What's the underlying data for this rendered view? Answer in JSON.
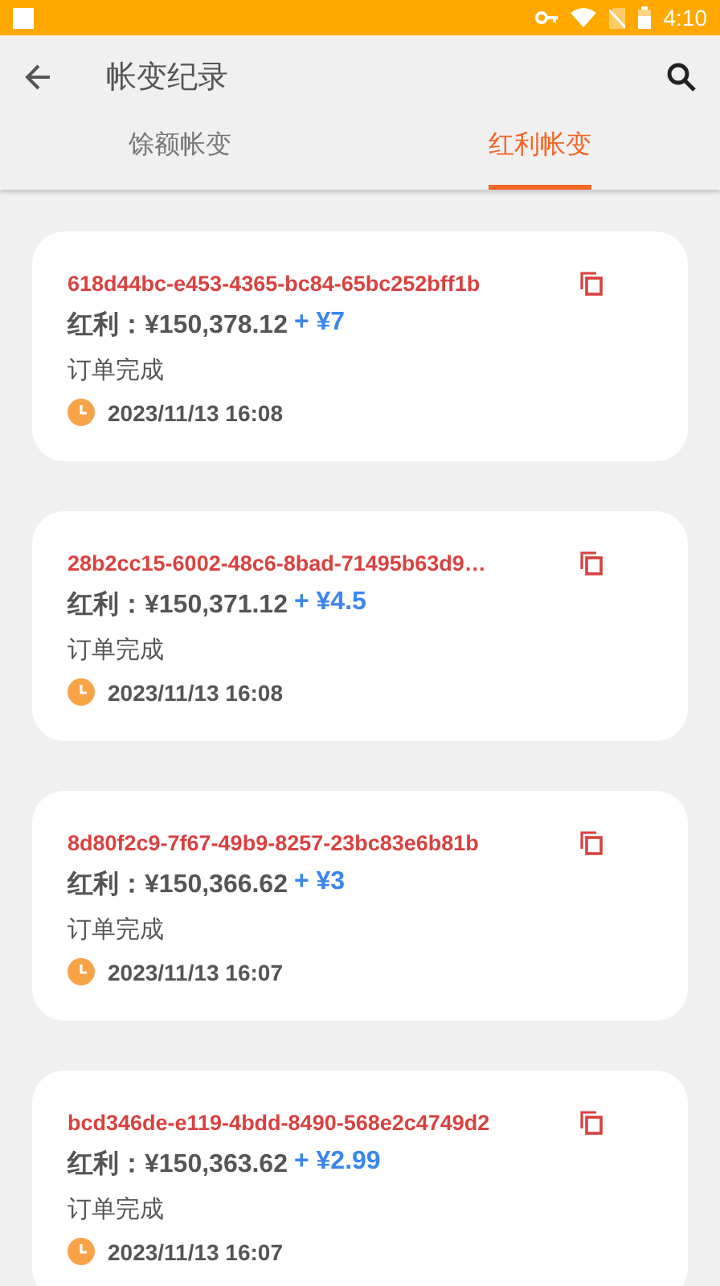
{
  "status_bar": {
    "time": "4:10"
  },
  "toolbar": {
    "title": "帐变纪录"
  },
  "tabs": [
    {
      "label": "馀额帐变",
      "selected": false
    },
    {
      "label": "红利帐变",
      "selected": true
    }
  ],
  "records": [
    {
      "id": "618d44bc-e453-4365-bc84-65bc252bff1b",
      "amount_label": "红利：¥150,378.12",
      "change": "+ ¥7",
      "status": "订单完成",
      "time": "2023/11/13 16:08"
    },
    {
      "id": "28b2cc15-6002-48c6-8bad-71495b63d9…",
      "amount_label": "红利：¥150,371.12",
      "change": "+ ¥4.5",
      "status": "订单完成",
      "time": "2023/11/13 16:08"
    },
    {
      "id": "8d80f2c9-7f67-49b9-8257-23bc83e6b81b",
      "amount_label": "红利：¥150,366.62",
      "change": "+ ¥3",
      "status": "订单完成",
      "time": "2023/11/13 16:07"
    },
    {
      "id": "bcd346de-e119-4bdd-8490-568e2c4749d2",
      "amount_label": "红利：¥150,363.62",
      "change": "+ ¥2.99",
      "status": "订单完成",
      "time": "2023/11/13 16:07"
    }
  ]
}
